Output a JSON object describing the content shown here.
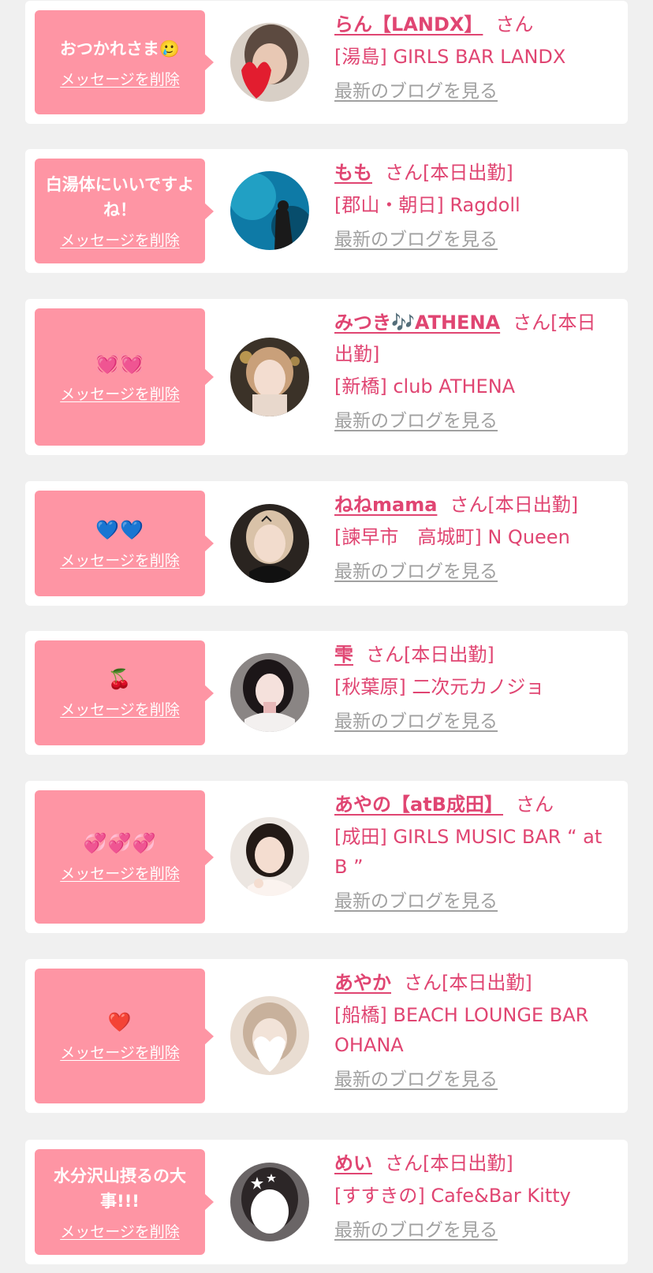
{
  "ui": {
    "delete_label": "メッセージを削除",
    "blog_label": "最新のブログを見る",
    "honorific": "さん"
  },
  "colors": {
    "accent": "#fe95a4",
    "text": "#e04572",
    "muted": "#a0a0a0"
  },
  "items": [
    {
      "message": "おつかれさま🥲",
      "name": "らん【LANDX】",
      "status": "",
      "shop": "[湯島] GIRLS BAR LANDX"
    },
    {
      "message": "白湯体にいいですよね！",
      "name": "もも",
      "status": "[本日出勤]",
      "shop": "[郡山・朝日] Ragdoll"
    },
    {
      "message": "💓💓",
      "name": "みつき🎶ATHENA",
      "status": "[本日出勤]",
      "shop": "[新橋] club ATHENA"
    },
    {
      "message": "💙💙",
      "name": "ねねmama",
      "status": "[本日出勤]",
      "shop": "[諫早市　高城町] N Queen"
    },
    {
      "message": "🍒",
      "name": "雫",
      "status": "[本日出勤]",
      "shop": "[秋葉原] 二次元カノジョ"
    },
    {
      "message": "💞💞💞",
      "name": "あやの【atB成田】",
      "status": "",
      "shop": "[成田] GIRLS MUSIC BAR “ at B ”"
    },
    {
      "message": "❤️",
      "name": "あやか",
      "status": "[本日出勤]",
      "shop": "[船橋] BEACH LOUNGE BAR OHANA"
    },
    {
      "message": "水分沢山摂るの大事!!!",
      "name": "めい",
      "status": "[本日出勤]",
      "shop": "[すすきの] Cafe&Bar Kitty"
    }
  ]
}
